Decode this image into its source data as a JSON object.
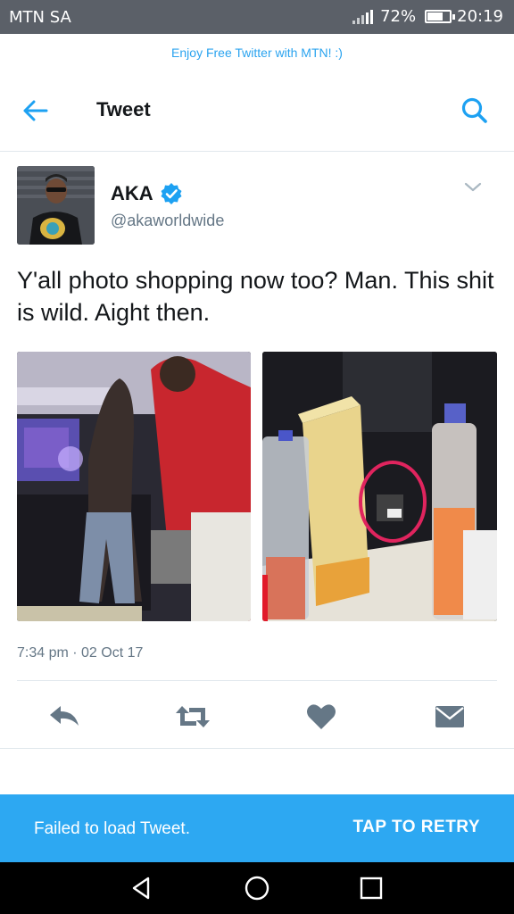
{
  "status_bar": {
    "carrier": "MTN SA",
    "battery": "72%",
    "battery_level": 0.72,
    "time": "20:19"
  },
  "promo_banner": "Enjoy Free Twitter with MTN! :)",
  "header": {
    "title": "Tweet",
    "back_icon": "arrow-left-icon",
    "search_icon": "search-icon"
  },
  "tweet": {
    "author_name": "AKA",
    "author_handle": "@akaworldwide",
    "verified": true,
    "text": "Y'all photo shopping now too? Man. This shit is wild. Aight then.",
    "timestamp": "7:34 pm · 02 Oct 17",
    "actions": [
      "reply-icon",
      "retweet-icon",
      "like-icon",
      "direct-message-icon"
    ]
  },
  "error_banner": {
    "message": "Failed to load Tweet.",
    "retry_label": "TAP TO RETRY"
  },
  "colors": {
    "twitter_blue": "#1da1f2",
    "banner_blue": "#2da8f2",
    "status_bar": "#5b6068",
    "muted_text": "#657786",
    "action_icon": "#657786"
  }
}
